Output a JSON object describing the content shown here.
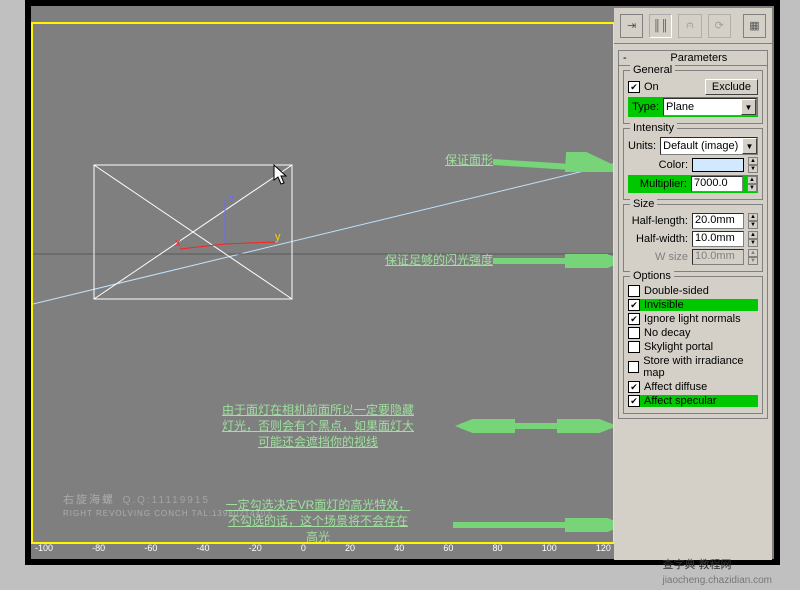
{
  "rollup_title": "Parameters",
  "general": {
    "legend": "General",
    "on": "On",
    "exclude": "Exclude",
    "type_label": "Type:",
    "type_value": "Plane"
  },
  "intensity": {
    "legend": "Intensity",
    "units_label": "Units:",
    "units_value": "Default (image)",
    "color_label": "Color:",
    "mult_label": "Multiplier:",
    "mult_value": "7000.0"
  },
  "size": {
    "legend": "Size",
    "hl_label": "Half-length:",
    "hl_value": "20.0mm",
    "hw_label": "Half-width:",
    "hw_value": "10.0mm",
    "ws_label": "W size",
    "ws_value": "10.0mm"
  },
  "options": {
    "legend": "Options",
    "double_sided": "Double-sided",
    "invisible": "Invisible",
    "ignore_normals": "Ignore light normals",
    "no_decay": "No decay",
    "skylight_portal": "Skylight portal",
    "store_irr": "Store with irradiance map",
    "affect_diffuse": "Affect diffuse",
    "affect_specular": "Affect specular"
  },
  "annotations": {
    "a1": "保证面形",
    "a2": "保证足够的闪光强度",
    "a3": "由于面灯在相机前面所以一定要隐藏\n灯光，否则会有个黑点，如果面灯大\n可能还会遮挡你的视线",
    "a4": "一定勾选决定VR面灯的高光特效，\n不勾选的话，这个场景将不会存在\n高光"
  },
  "watermark": {
    "top": "右旋海螺",
    "qq": "Q.Q:11119915",
    "sub": "RIGHT REVOLVING CONCH  TAL:13980214403"
  },
  "ruler": [
    "-100",
    "-80",
    "-60",
    "-40",
    "-20",
    "0",
    "20",
    "40",
    "60",
    "80",
    "100",
    "120"
  ],
  "footer": "查字典  教程网",
  "footer_url": "jiaocheng.chazidian.com"
}
